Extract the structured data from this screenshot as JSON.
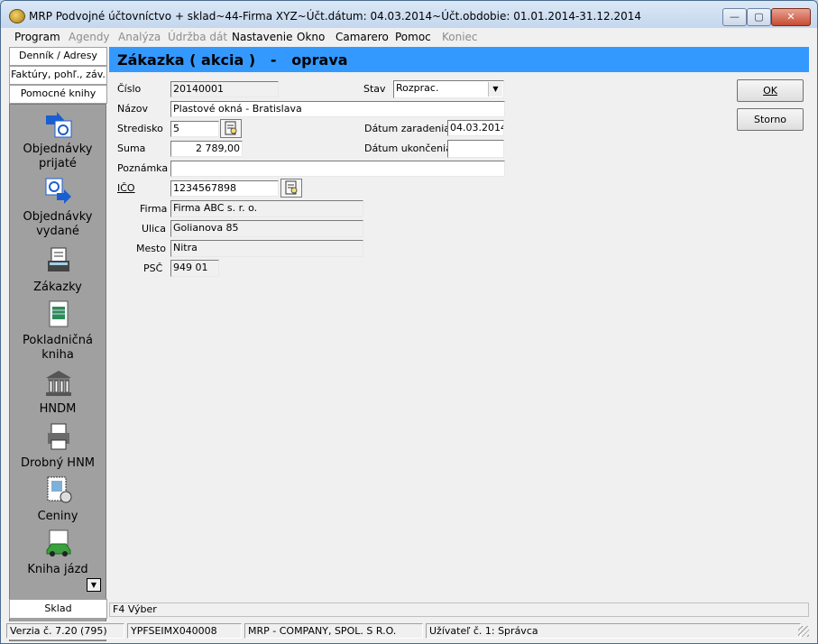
{
  "window": {
    "title": "MRP Podvojné účtovníctvo + sklad~44-Firma XYZ~Účt.dátum: 04.03.2014~Účt.obdobie: 01.01.2014-31.12.2014",
    "controls": {
      "minimize": "—",
      "maximize": "▢",
      "close": "✕"
    }
  },
  "menu": [
    "Program",
    "Agendy",
    "Analýza",
    "Údržba dát",
    "Nastavenie",
    "Okno",
    "Camarero",
    "Pomoc",
    "Koniec"
  ],
  "left_tabs": [
    "Denník / Adresy",
    "Faktúry, pohľ., záv.",
    "Pomocné knihy"
  ],
  "nav_items": [
    {
      "label_line1": "Objednávky",
      "label_line2": "prijaté",
      "icon": "order-in-icon"
    },
    {
      "label_line1": "Objednávky",
      "label_line2": "vydané",
      "icon": "order-out-icon"
    },
    {
      "label_line1": "Zákazky",
      "label_line2": "",
      "icon": "contracts-icon"
    },
    {
      "label_line1": "Pokladničná",
      "label_line2": "kniha",
      "icon": "cash-register-icon"
    },
    {
      "label_line1": "HNDM",
      "label_line2": "",
      "icon": "building-icon"
    },
    {
      "label_line1": "Drobný HNM",
      "label_line2": "",
      "icon": "printer-icon"
    },
    {
      "label_line1": "Ceniny",
      "label_line2": "",
      "icon": "stamps-icon"
    },
    {
      "label_line1": "Kniha jázd",
      "label_line2": "",
      "icon": "car-icon"
    }
  ],
  "sklad_tab": "Sklad",
  "header": {
    "title": "Zákazka ( akcia )   -   oprava"
  },
  "form": {
    "cislo_label": "Číslo",
    "cislo_value": "20140001",
    "stav_label": "Stav",
    "stav_value": "Rozprac.",
    "nazov_label": "Názov",
    "nazov_value": "Plastové okná - Bratislava",
    "stredisko_label": "Stredisko",
    "stredisko_value": "5",
    "datum_zaradenia_label": "Dátum zaradenia",
    "datum_zaradenia_value": "04.03.2014",
    "suma_label": "Suma",
    "suma_value": "2 789,00",
    "datum_ukoncenia_label": "Dátum ukončenia",
    "datum_ukoncenia_value": "",
    "poznamka_label": "Poznámka",
    "poznamka_value": "",
    "ico_label": "IČO",
    "ico_value": "1234567898",
    "firma_label": "Firma",
    "firma_value": "Firma ABC s. r. o.",
    "ulica_label": "Ulica",
    "ulica_value": "Golianova 85",
    "mesto_label": "Mesto",
    "mesto_value": "Nitra",
    "psc_label": "PSČ",
    "psc_value": "949 01"
  },
  "buttons": {
    "ok": "OK",
    "storno": "Storno"
  },
  "f4_hint": "F4 Výber",
  "status": {
    "version": "Verzia č. 7.20 (795)",
    "code": "YPFSEIMX040008",
    "company": "MRP - COMPANY, SPOL. S R.O.",
    "user": "Užívateľ č. 1: Správca"
  },
  "colors": {
    "header_bg": "#3399ff",
    "nav_bg": "#a0a0a0"
  }
}
